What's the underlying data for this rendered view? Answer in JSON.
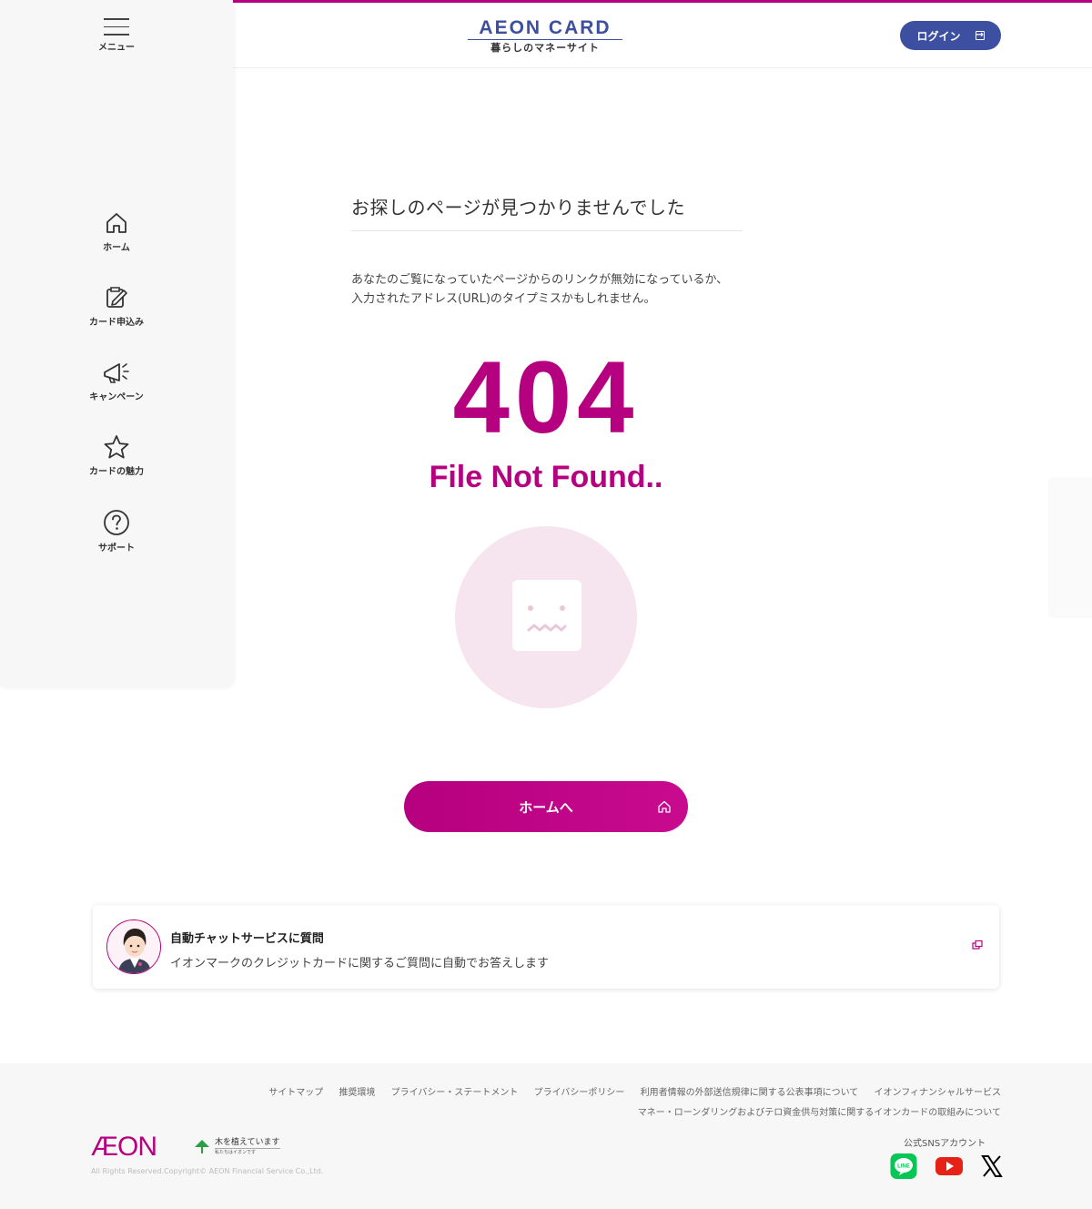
{
  "header": {
    "logo_main": "AEON CARD",
    "logo_sub": "暮らしのマネーサイト",
    "login_label": "ログイン"
  },
  "sidebar": {
    "menu_label": "メニュー",
    "items": [
      {
        "label": "ホーム",
        "icon": "home-icon"
      },
      {
        "label": "カード申込み",
        "icon": "application-form-icon"
      },
      {
        "label": "キャンペーン",
        "icon": "megaphone-icon"
      },
      {
        "label": "カードの魅力",
        "icon": "star-icon"
      },
      {
        "label": "サポート",
        "icon": "question-icon"
      }
    ]
  },
  "main": {
    "title": "お探しのページが見つかりませんでした",
    "description": "あなたのご覧になっていたページからのリンクが無効になっているか、入力されたアドレス(URL)のタイプミスかもしれません。",
    "error_code": "404",
    "error_text": "File Not Found..",
    "home_button_label": "ホームへ"
  },
  "chat": {
    "title": "自動チャットサービスに質問",
    "subtitle": "イオンマークのクレジットカードに関するご質問に自動でお答えします"
  },
  "footer": {
    "links": [
      "サイトマップ",
      "推奨環境",
      "プライバシー・ステートメント",
      "プライバシーポリシー",
      "利用者情報の外部送信規律に関する公表事項について",
      "イオンフィナンシャルサービス",
      "マネー・ローンダリングおよびテロ資金供与対策に関するイオンカードの取組みについて"
    ],
    "aeon_logo": "ÆON",
    "tree_text": "木を植えています",
    "tree_sub": "私たちはイオンです",
    "copyright": "All Rights Reserved.Copyright© AEON Financial Service Co.,Ltd.",
    "sns_label": "公式SNSアカウント",
    "sns": [
      {
        "name": "line",
        "label": "LINE",
        "color": "#06c755"
      },
      {
        "name": "youtube",
        "color": "#e62117"
      },
      {
        "name": "x",
        "color": "#000000"
      }
    ]
  },
  "colors": {
    "accent": "#b5007f",
    "brand_blue": "#3d4fa0"
  }
}
